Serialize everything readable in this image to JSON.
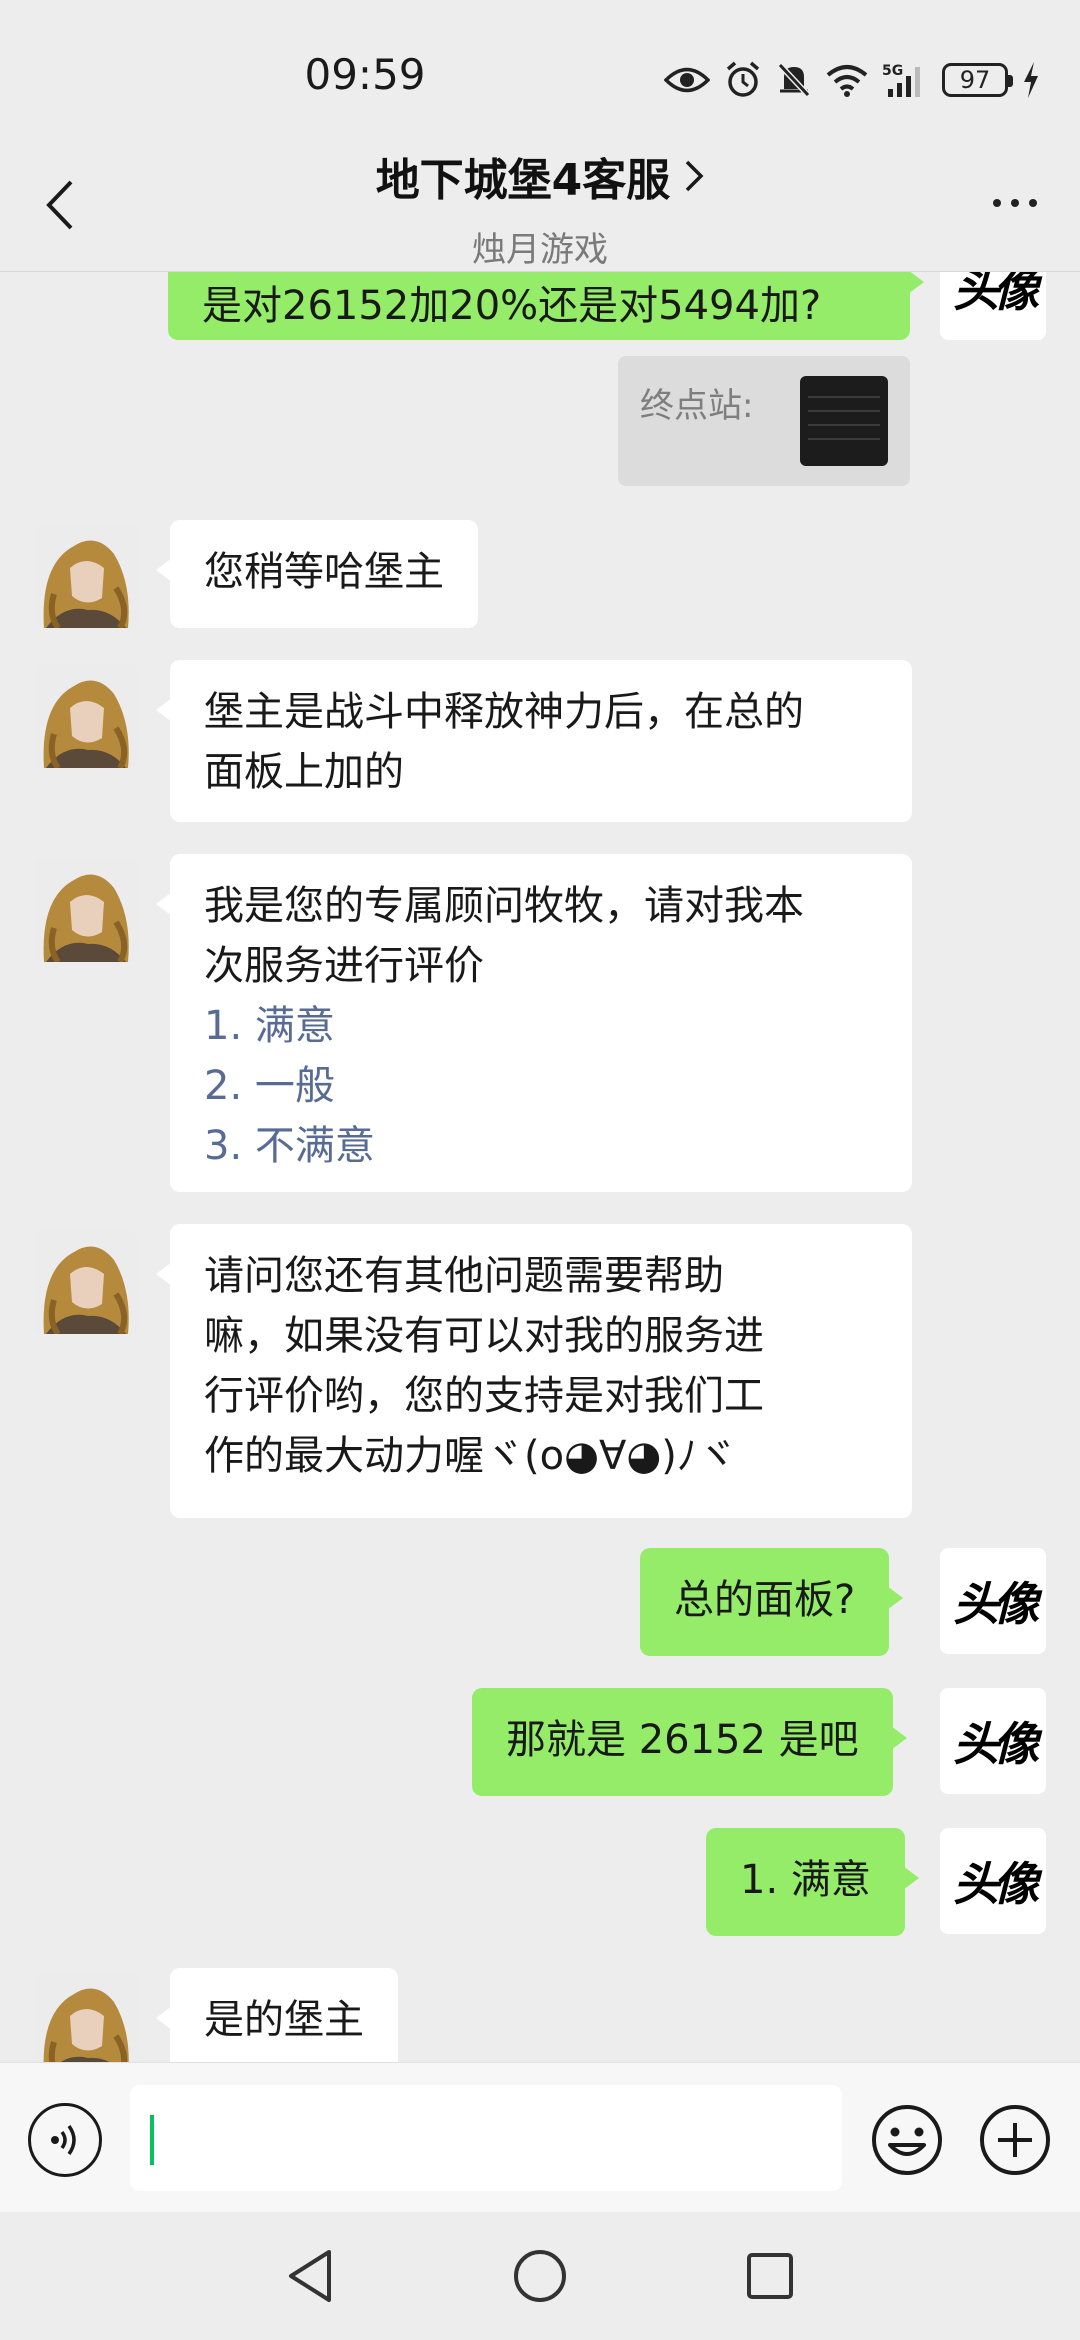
{
  "status_bar": {
    "time": "09:59",
    "battery": "97",
    "icons": [
      "eye-icon",
      "alarm-icon",
      "mute-icon",
      "wifi-icon",
      "signal-5g-icon",
      "battery-icon",
      "charging-icon"
    ]
  },
  "header": {
    "title": "地下城堡4客服",
    "subtitle": "烛月游戏"
  },
  "messages": [
    {
      "sender": "me",
      "text": "是对26152加20%还是对5494加?"
    },
    {
      "sender": "me",
      "type": "quote",
      "label": "终点站:"
    },
    {
      "sender": "agent",
      "text": "您稍等哈堡主"
    },
    {
      "sender": "agent",
      "lines": [
        "堡主是战斗中释放神力后，在总的",
        "面板上加的"
      ]
    },
    {
      "sender": "agent",
      "lines": [
        "我是您的专属顾问牧牧，请对我本",
        "次服务进行评价"
      ],
      "options": [
        "1. 满意",
        "2. 一般",
        "3. 不满意"
      ]
    },
    {
      "sender": "agent",
      "lines": [
        "请问您还有其他问题需要帮助",
        "嘛，如果没有可以对我的服务进",
        "行评价哟，您的支持是对我们工",
        "作的最大动力喔ヾ(o◕∀◕)ﾉヾ"
      ]
    },
    {
      "sender": "me",
      "text": "总的面板?"
    },
    {
      "sender": "me",
      "text": "那就是 26152 是吧"
    },
    {
      "sender": "me",
      "text": "1. 满意"
    },
    {
      "sender": "agent",
      "text": "是的堡主"
    }
  ],
  "my_avatar_text": "头像",
  "input": {
    "value": "",
    "placeholder": ""
  },
  "colors": {
    "my_bubble": "#95ec69",
    "agent_bubble": "#ffffff",
    "link": "#576b95",
    "background": "#ededed"
  }
}
